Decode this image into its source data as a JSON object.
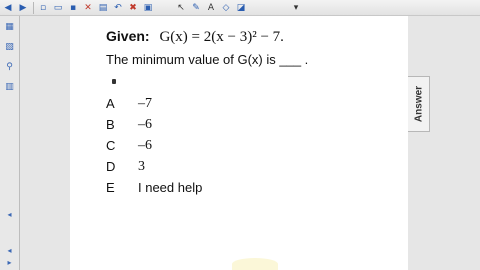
{
  "toolbar": {
    "icons": [
      "back-icon",
      "forward-icon",
      "new-page-icon",
      "open-icon",
      "save-icon",
      "delete-icon",
      "paste-icon",
      "undo-icon",
      "close-icon",
      "screen-icon",
      "pointer-icon",
      "pen-icon",
      "text-icon",
      "shape-icon",
      "fill-icon",
      "expand-icon"
    ]
  },
  "sidebar": {
    "tabs": [
      "page-sorter-icon",
      "gallery-icon",
      "attachments-icon",
      "properties-icon"
    ]
  },
  "question": {
    "given_label": "Given:",
    "given_equation": "G(x) = 2(x − 3)² − 7.",
    "prompt": "The minimum value of G(x) is ___ ."
  },
  "choices": [
    {
      "letter": "A",
      "text": "–7"
    },
    {
      "letter": "B",
      "text": "–6"
    },
    {
      "letter": "C",
      "text": "–6"
    },
    {
      "letter": "D",
      "text": "3"
    },
    {
      "letter": "E",
      "text": "I need help"
    }
  ],
  "answer_tab": {
    "label": "Answer"
  }
}
